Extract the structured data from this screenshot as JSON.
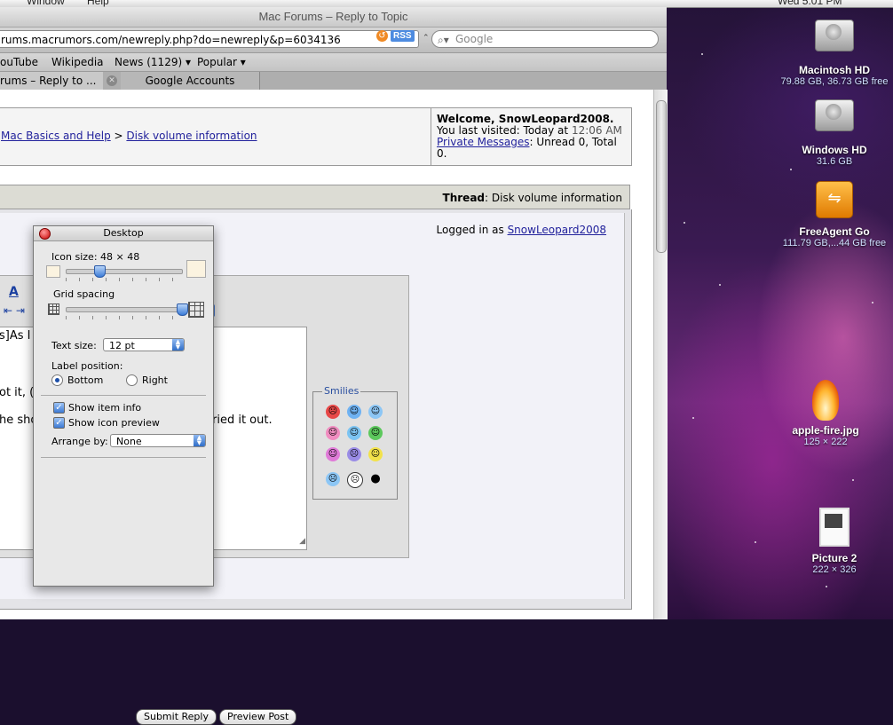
{
  "menubar": {
    "left": [
      "Window",
      "Help"
    ],
    "clock": "Wed 5:01 PM"
  },
  "browser": {
    "title": "Mac Forums – Reply to Topic",
    "url": "rums.macrumors.com/newreply.php?do=newreply&p=6034136",
    "rss": "RSS",
    "search_placeholder": "Google",
    "bookmarks": [
      "ouTube",
      "Wikipedia",
      "News (1129) ▾",
      "Popular ▾"
    ],
    "tabs": [
      "rums – Reply to ...",
      "Google Accounts"
    ]
  },
  "page": {
    "breadcrumb_1": "Mac Basics and Help",
    "breadcrumb_sep": ">",
    "breadcrumb_2": "Disk volume information",
    "welcome_title": "Welcome, SnowLeopard2008.",
    "last_visited_prefix": "You last visited: Today at ",
    "last_visited_time": "12:06 AM",
    "pm_link": "Private Messages",
    "pm_status": ": Unread 0, Total 0.",
    "thread_label": "Thread",
    "thread_title": ": Disk volume information",
    "logged_in_prefix": "Logged in as ",
    "logged_in_user": "SnowLeopard2008",
    "text_lines": [
      "s]As I",
      "ot it, (",
      "he sho",
      "ried it out."
    ],
    "smilies_label": "Smilies",
    "submit_label": "Submit Reply",
    "preview_label": "Preview Post"
  },
  "panel": {
    "title": "Desktop",
    "icon_size_label": "Icon size: 48 × 48",
    "icon_size": 48,
    "icon_size_range": [
      16,
      128
    ],
    "grid_spacing_label": "Grid spacing",
    "grid_spacing_level": 1.0,
    "text_size_label": "Text size:",
    "text_size_value": "12 pt",
    "label_position_label": "Label position:",
    "label_bottom": "Bottom",
    "label_right": "Right",
    "show_item_info": "Show item info",
    "show_icon_preview": "Show icon preview",
    "arrange_by_label": "Arrange by:",
    "arrange_by_value": "None"
  },
  "desktop_icons": [
    {
      "name": "Macintosh HD",
      "info": "79.88 GB, 36.73 GB free"
    },
    {
      "name": "Windows HD",
      "info": "31.6 GB"
    },
    {
      "name": "FreeAgent Go",
      "info": "111.79 GB,...44 GB free"
    },
    {
      "name": "apple-fire.jpg",
      "info": "125 × 222"
    },
    {
      "name": "Picture 2",
      "info": "222 × 326"
    }
  ]
}
